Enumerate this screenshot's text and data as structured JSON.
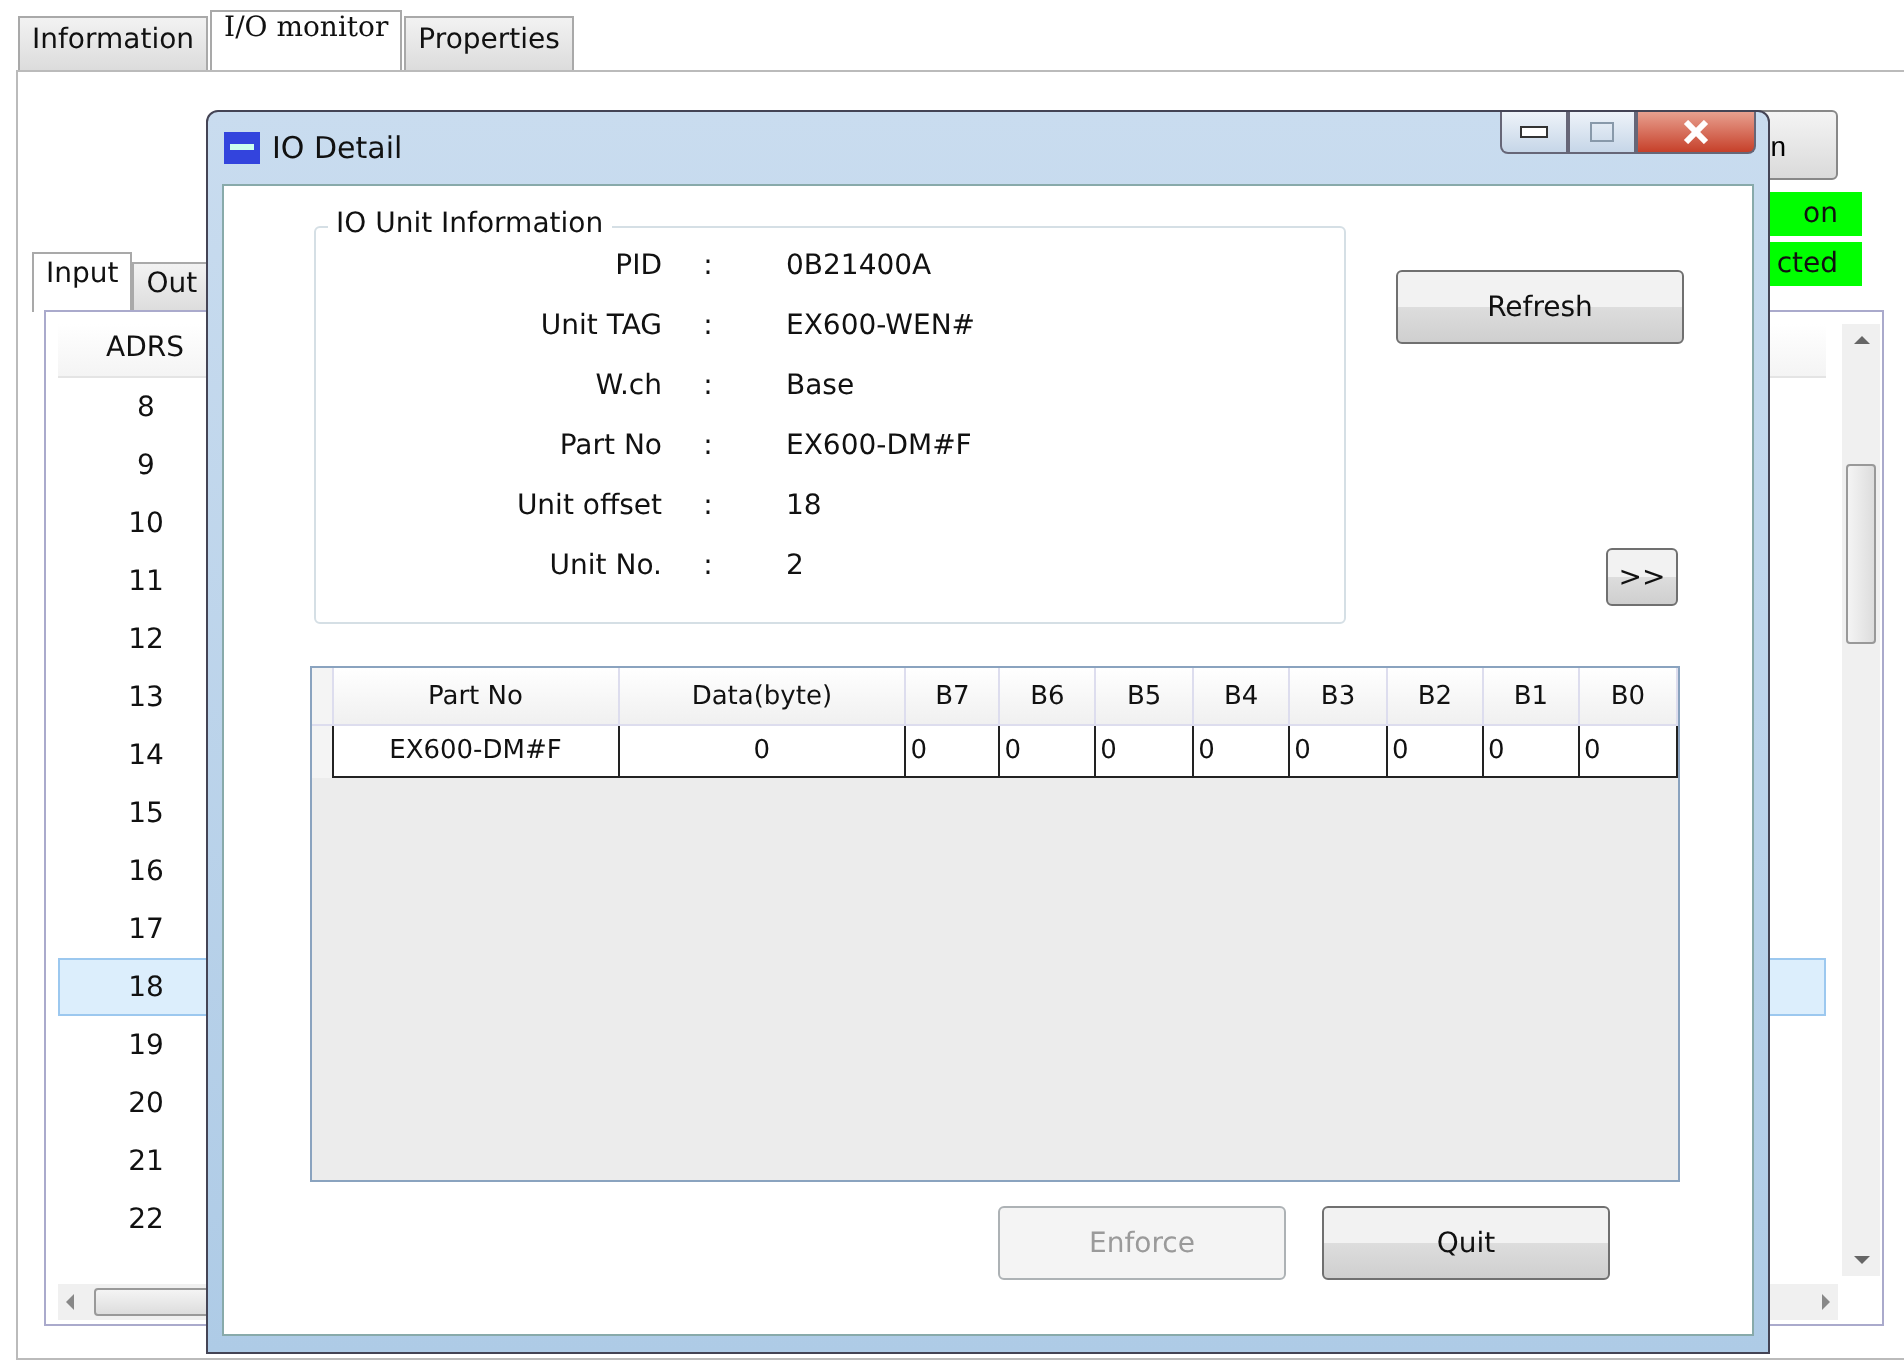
{
  "main_tabs": [
    {
      "label": "Information",
      "selected": false
    },
    {
      "label": "I/O monitor",
      "selected": true
    },
    {
      "label": "Properties",
      "selected": false
    }
  ],
  "connect_button": {
    "label": "n"
  },
  "status_labels": [
    "on",
    "cted"
  ],
  "io_tabs": [
    {
      "label": "Input",
      "selected": true
    },
    {
      "label": "Out",
      "selected": false
    }
  ],
  "address_list": {
    "header": "ADRS",
    "rows": [
      {
        "adrs": "8",
        "selected": false
      },
      {
        "adrs": "9",
        "selected": false
      },
      {
        "adrs": "10",
        "selected": false
      },
      {
        "adrs": "11",
        "selected": false
      },
      {
        "adrs": "12",
        "selected": false
      },
      {
        "adrs": "13",
        "selected": false
      },
      {
        "adrs": "14",
        "selected": false
      },
      {
        "adrs": "15",
        "selected": false
      },
      {
        "adrs": "16",
        "selected": false
      },
      {
        "adrs": "17",
        "selected": false
      },
      {
        "adrs": "18",
        "selected": true
      },
      {
        "adrs": "19",
        "selected": false
      },
      {
        "adrs": "20",
        "selected": false
      },
      {
        "adrs": "21",
        "selected": false
      },
      {
        "adrs": "22",
        "selected": false
      }
    ]
  },
  "dialog": {
    "title": "IO Detail",
    "group_title": "IO Unit Information",
    "fields": [
      {
        "label": "PID",
        "value": "0B21400A"
      },
      {
        "label": "Unit TAG",
        "value": "EX600-WEN#"
      },
      {
        "label": "W.ch",
        "value": "Base"
      },
      {
        "label": "Part No",
        "value": "EX600-DM#F"
      },
      {
        "label": "Unit offset",
        "value": "18"
      },
      {
        "label": "Unit No.",
        "value": "2"
      }
    ],
    "separator": ":",
    "refresh_button": "Refresh",
    "expand_button": ">>",
    "grid": {
      "columns": [
        "Part No",
        "Data(byte)",
        "B7",
        "B6",
        "B5",
        "B4",
        "B3",
        "B2",
        "B1",
        "B0"
      ],
      "rows": [
        [
          "EX600-DM#F",
          "0",
          "0",
          "0",
          "0",
          "0",
          "0",
          "0",
          "0",
          "0"
        ]
      ]
    },
    "buttons": [
      {
        "label": "Enforce",
        "disabled": true
      },
      {
        "label": "Quit",
        "disabled": false
      }
    ]
  }
}
